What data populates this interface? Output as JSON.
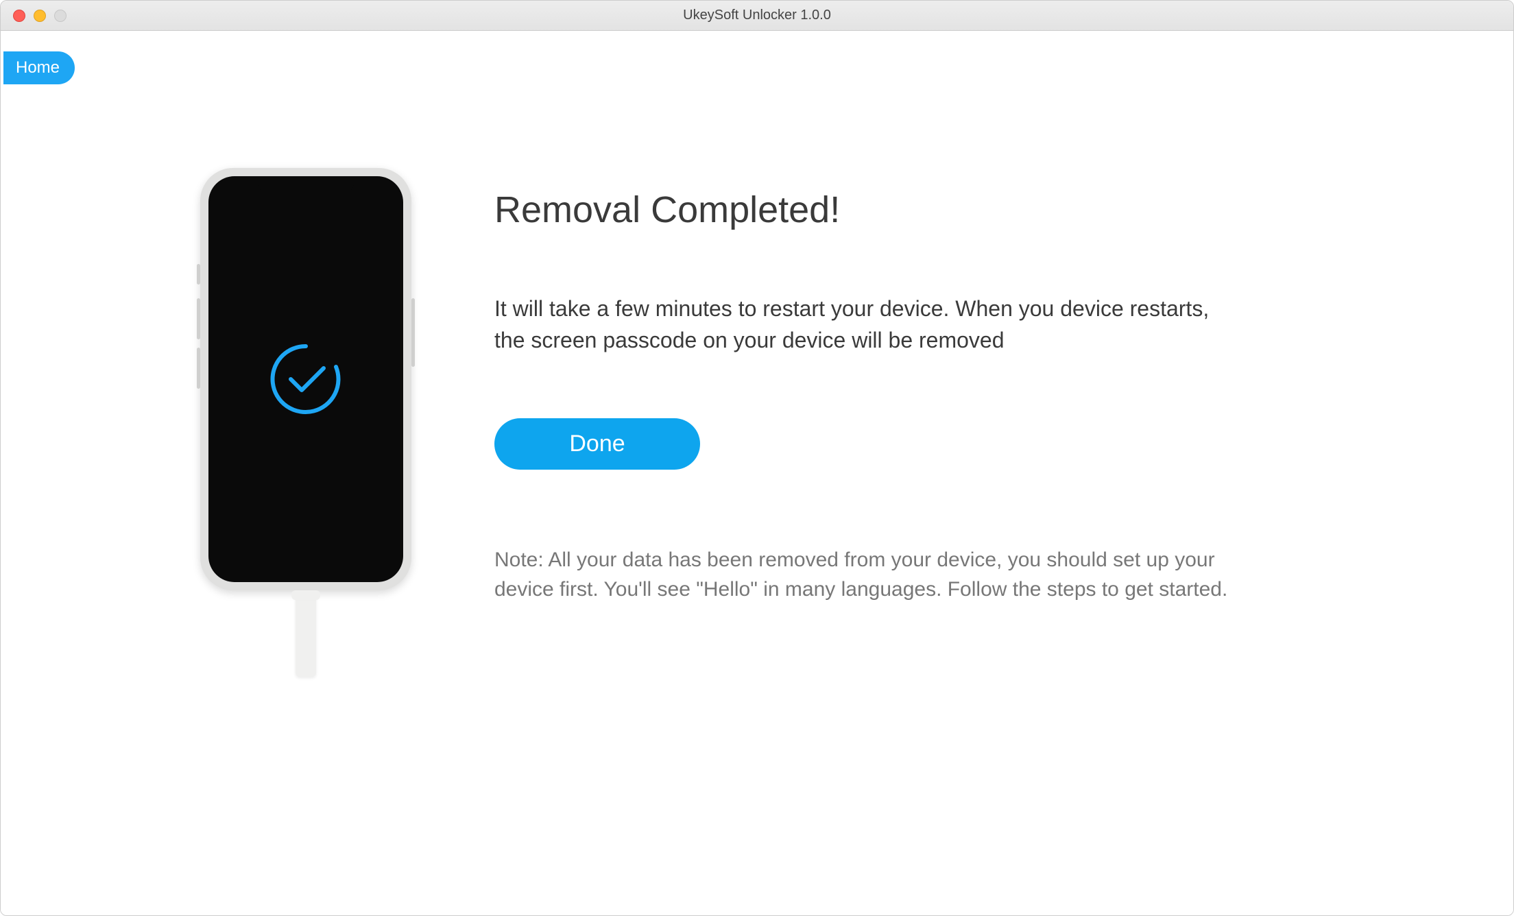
{
  "window": {
    "title": "UkeySoft Unlocker 1.0.0"
  },
  "nav": {
    "home_label": "Home"
  },
  "main": {
    "heading": "Removal Completed!",
    "description": "It will take a few minutes to restart your device. When you device restarts, the screen passcode on your device will be removed",
    "done_label": "Done",
    "note": "Note: All your data has been removed from your device, you should set up your device first. You'll see \"Hello\" in many languages. Follow the steps to get started."
  },
  "icons": {
    "check": "check-circle-progress-icon"
  },
  "colors": {
    "accent": "#0ea5ee"
  }
}
